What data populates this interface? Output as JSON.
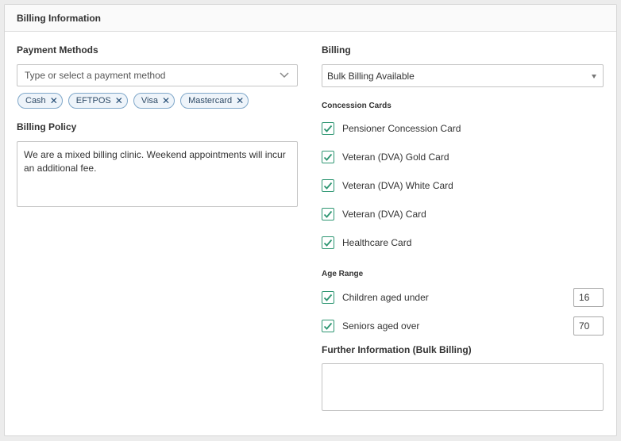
{
  "panel": {
    "title": "Billing Information"
  },
  "payment": {
    "label": "Payment Methods",
    "placeholder": "Type or select a payment method",
    "chips": [
      "Cash",
      "EFTPOS",
      "Visa",
      "Mastercard"
    ]
  },
  "policy": {
    "label": "Billing Policy",
    "text": "We are a mixed billing clinic. Weekend appointments will incur an additional fee."
  },
  "billing": {
    "label": "Billing",
    "selected": "Bulk Billing Available"
  },
  "concession": {
    "label": "Concession Cards",
    "items": [
      {
        "label": "Pensioner Concession Card",
        "checked": true
      },
      {
        "label": "Veteran (DVA) Gold Card",
        "checked": true
      },
      {
        "label": "Veteran (DVA) White Card",
        "checked": true
      },
      {
        "label": "Veteran (DVA) Card",
        "checked": true
      },
      {
        "label": "Healthcare Card",
        "checked": true
      }
    ]
  },
  "age": {
    "label": "Age Range",
    "children": {
      "label": "Children aged under",
      "value": "16",
      "checked": true
    },
    "seniors": {
      "label": "Seniors aged over",
      "value": "70",
      "checked": true
    }
  },
  "further": {
    "label": "Further Information (Bulk Billing)",
    "text": ""
  },
  "colors": {
    "check": "#2e9672",
    "chip_border": "#7fa7c9",
    "chip_bg": "#eef4fa"
  }
}
